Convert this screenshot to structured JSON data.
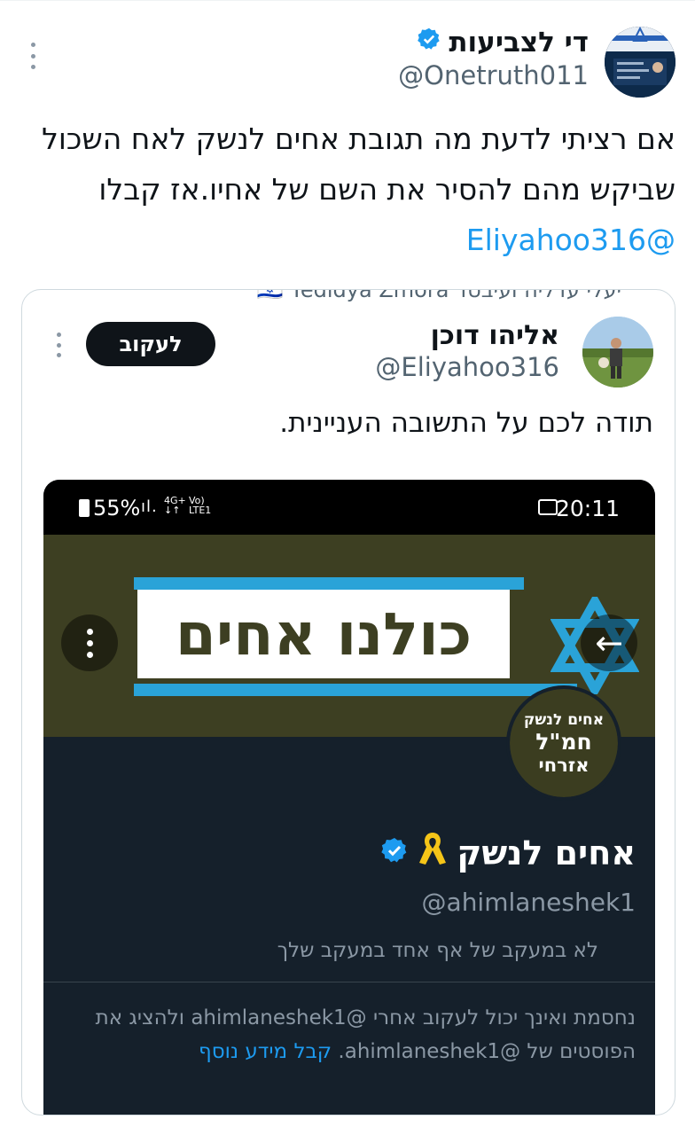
{
  "tweet": {
    "author_name": "די לצביעות",
    "author_handle": "@Onetruth011",
    "text_part1": "אם רציתי לדעת מה תגובת אחים לנשק לאח השכול שביקש מהם להסיר את השם של אחיו.אז קבלו ",
    "mention": "@Eliyahoo316"
  },
  "quote": {
    "clipped_text": "יעלי עדליה ועיבטד 🇮🇱 Yedidya Zmora",
    "author_name": "אליהו דוכן",
    "author_handle": "@Eliyahoo316",
    "follow_label": "לעקוב",
    "text": "תודה לכם על התשובה העניינית."
  },
  "screenshot": {
    "status": {
      "battery": "55%",
      "net1_top": "4G+",
      "net1_bottom": "↓↑",
      "net2_top": "Vo)",
      "net2_bottom": "LTE1",
      "time": "20:11"
    },
    "banner_text": "כולנו אחים",
    "avatar_text": {
      "line1": "אחים לנשק",
      "line2": "חמ\"ל",
      "line3": "אזרחי"
    },
    "profile_name": "אחים לנשק",
    "profile_handle": "@ahimlaneshek1",
    "not_following_text": "לא במעקב של אף אחד במעקב שלך",
    "blocked_text": "נחסמת ואינך יכול לעקוב אחרי @ahimlaneshek1 ולהציג את הפוסטים של @ahimlaneshek1. ",
    "learn_more": "קבל מידע נוסף"
  },
  "colors": {
    "accent": "#1d9bf0",
    "banner_bg": "#3d3f22",
    "stripe": "#2aa3d8",
    "ribbon": "#f5c518",
    "dark_bg": "#15202b"
  },
  "icons": [
    "verified-badge-icon",
    "more-icon",
    "back-arrow-icon",
    "star-of-david-icon",
    "yellow-ribbon-icon",
    "gallery-icon"
  ]
}
